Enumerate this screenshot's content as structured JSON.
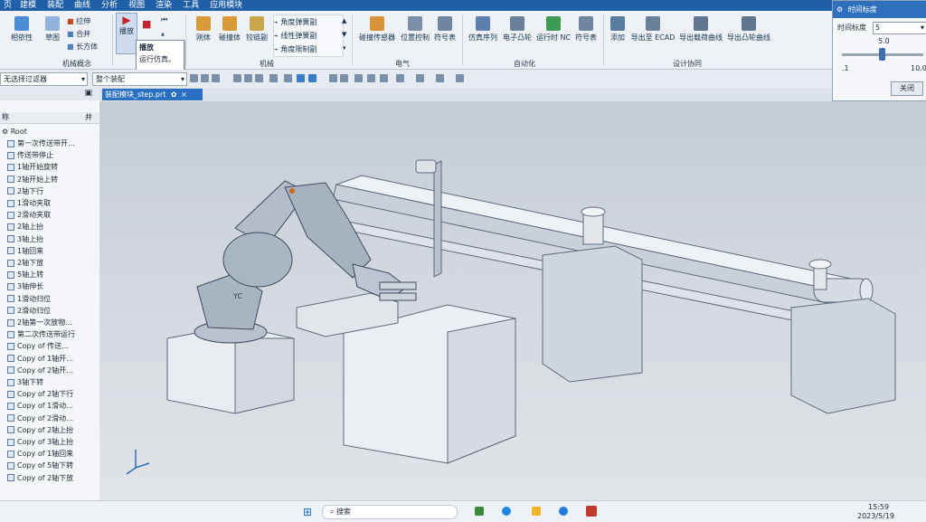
{
  "menubar": {
    "items": [
      "页",
      "建模",
      "装配",
      "曲线",
      "分析",
      "视图",
      "渲染",
      "工具",
      "应用模块"
    ]
  },
  "ribbon": {
    "left_buttons": [
      "相依性",
      "草图"
    ],
    "small_buttons": [
      "拉伸",
      "合并",
      "长方体"
    ],
    "group_mech_concept": "机械概念",
    "play_button": "播放",
    "rigid_buttons": [
      "刚体",
      "碰撞体",
      "铰链副"
    ],
    "joint_items": [
      "角度弹簧副",
      "线性弹簧副",
      "角度限制副"
    ],
    "group_mechanical": "机械",
    "electrical_buttons": [
      "碰撞传感器",
      "位置控制",
      "符号表"
    ],
    "group_electrical": "电气",
    "automation_buttons": [
      "仿真序列",
      "电子凸轮",
      "运行时 NC",
      "符号表"
    ],
    "group_automation": "自动化",
    "design_buttons": [
      "添加",
      "导出至 ECAD",
      "导出载荷曲线",
      "导出凸轮曲线"
    ],
    "group_design_collab": "设计协同"
  },
  "tooltip": {
    "title": "播放",
    "body": "运行仿真。"
  },
  "toolbar": {
    "filter_value": "无选择过滤器",
    "assembly_value": "整个装配"
  },
  "file_tab": {
    "label": "装配模块_step.prt",
    "modified": "✿",
    "close": "×"
  },
  "navigator": {
    "col_name": "称",
    "col_right": "井",
    "root": "Root",
    "items": [
      "第一次传送带开…",
      "传送带停止",
      "1轴开始旋转",
      "2轴开始上转",
      "2轴下行",
      "1滑动夹取",
      "2滑动夹取",
      "2轴上抬",
      "3轴上抬",
      "1轴回来",
      "2轴下放",
      "5轴上转",
      "3轴伸长",
      "1滑动归位",
      "2滑动归位",
      "2轴第一次放物…",
      "第二次传送带运行",
      "Copy of 传送…",
      "Copy of 1轴开…",
      "Copy of 2轴开…",
      "3轴下转",
      "Copy of 2轴下行",
      "Copy of 1滑动…",
      "Copy of 2滑动…",
      "Copy of 2轴上抬",
      "Copy of 3轴上抬",
      "Copy of 1轴回来",
      "Copy of 5轴下转",
      "Copy of 2轴下放"
    ]
  },
  "dialog": {
    "title": "时间标度",
    "label": "时间标度",
    "select_value": "5",
    "slider_value": "5.0",
    "slider_min": ".1",
    "slider_max": "10.0",
    "slider_fraction": 0.49,
    "close_button": "关闭"
  },
  "taskbar": {
    "search": "搜索",
    "time": "15:59",
    "date": "2023/5/19"
  },
  "viewport": {
    "robot_label": "YC"
  },
  "colors": {
    "accent": "#1f5fa8",
    "tab": "#2b6fc2",
    "viewport": "#cfd5dc"
  }
}
